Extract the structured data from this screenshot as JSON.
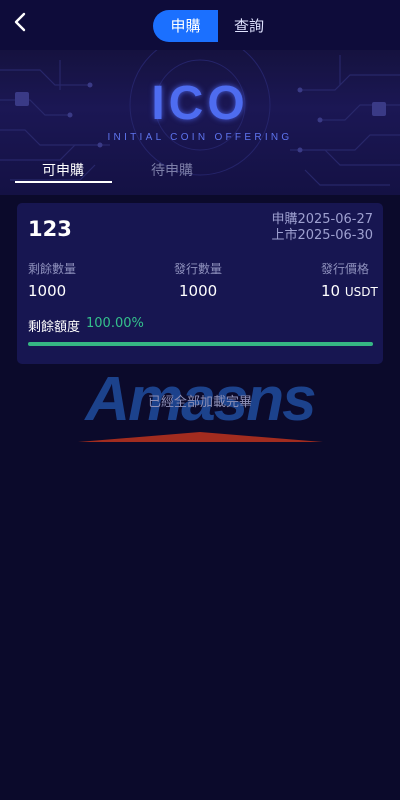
{
  "header": {
    "tabs": [
      {
        "label": "申購",
        "active": true
      },
      {
        "label": "查詢",
        "active": false
      }
    ]
  },
  "banner": {
    "title": "ICO",
    "subtitle": "INITIAL COIN OFFERING"
  },
  "subtabs": [
    {
      "label": "可申購",
      "active": true
    },
    {
      "label": "待申購",
      "active": false
    }
  ],
  "card": {
    "name": "123",
    "subscribe_date": "申購2025-06-27",
    "listing_date": "上市2025-06-30",
    "stats": [
      {
        "label": "剩餘數量",
        "value": "1000",
        "unit": ""
      },
      {
        "label": "發行數量",
        "value": "1000",
        "unit": ""
      },
      {
        "label": "發行價格",
        "value": "10",
        "unit": "USDT"
      }
    ],
    "remaining_label": "剩餘額度",
    "remaining_pct": "100.00%",
    "progress": 1.0
  },
  "watermark": {
    "text": "Amasns"
  },
  "footer_text": "已經全部加載完畢",
  "colors": {
    "background": "#0b0a2b",
    "accent": "#1b70ff",
    "card": "#171651",
    "progress": "#35b783",
    "ico": "#4e6cf0"
  }
}
